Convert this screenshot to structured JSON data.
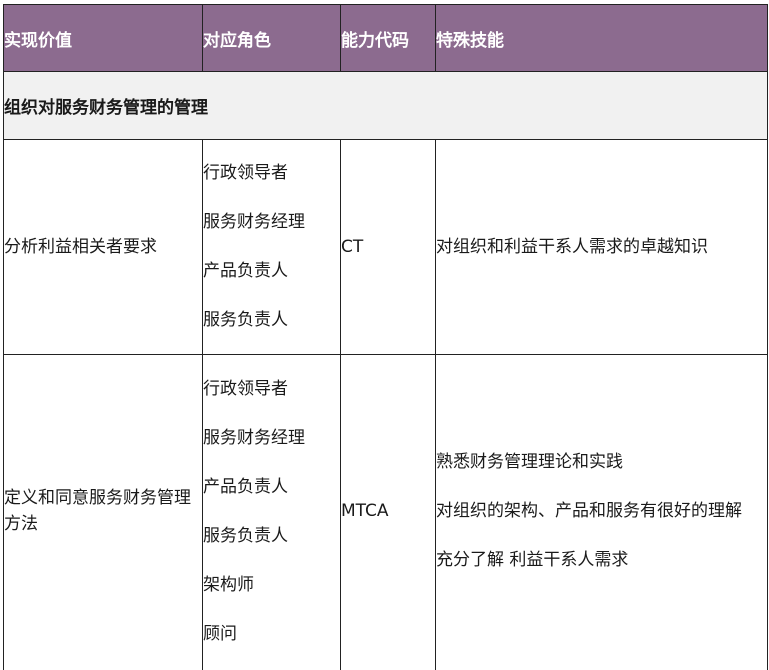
{
  "header": {
    "col1": "实现价值",
    "col2": "对应角色",
    "col3": "能力代码",
    "col4": "特殊技能"
  },
  "section": {
    "title": "组织对服务财务管理的管理"
  },
  "rows": [
    {
      "value": "分析利益相关者要求",
      "roles": [
        "行政领导者",
        "服务财务经理",
        "产品负责人",
        "服务负责人"
      ],
      "code": "CT",
      "skills": [
        "对组织和利益干系人需求的卓越知识"
      ]
    },
    {
      "value": "定义和同意服务财务管理方法",
      "roles": [
        "行政领导者",
        "服务财务经理",
        "产品负责人",
        "服务负责人",
        "架构师",
        "顾问"
      ],
      "code": "MTCA",
      "skills": [
        "熟悉财务管理理论和实践",
        "对组织的架构、产品和服务有很好的理解",
        "充分了解 利益干系人需求"
      ]
    }
  ]
}
